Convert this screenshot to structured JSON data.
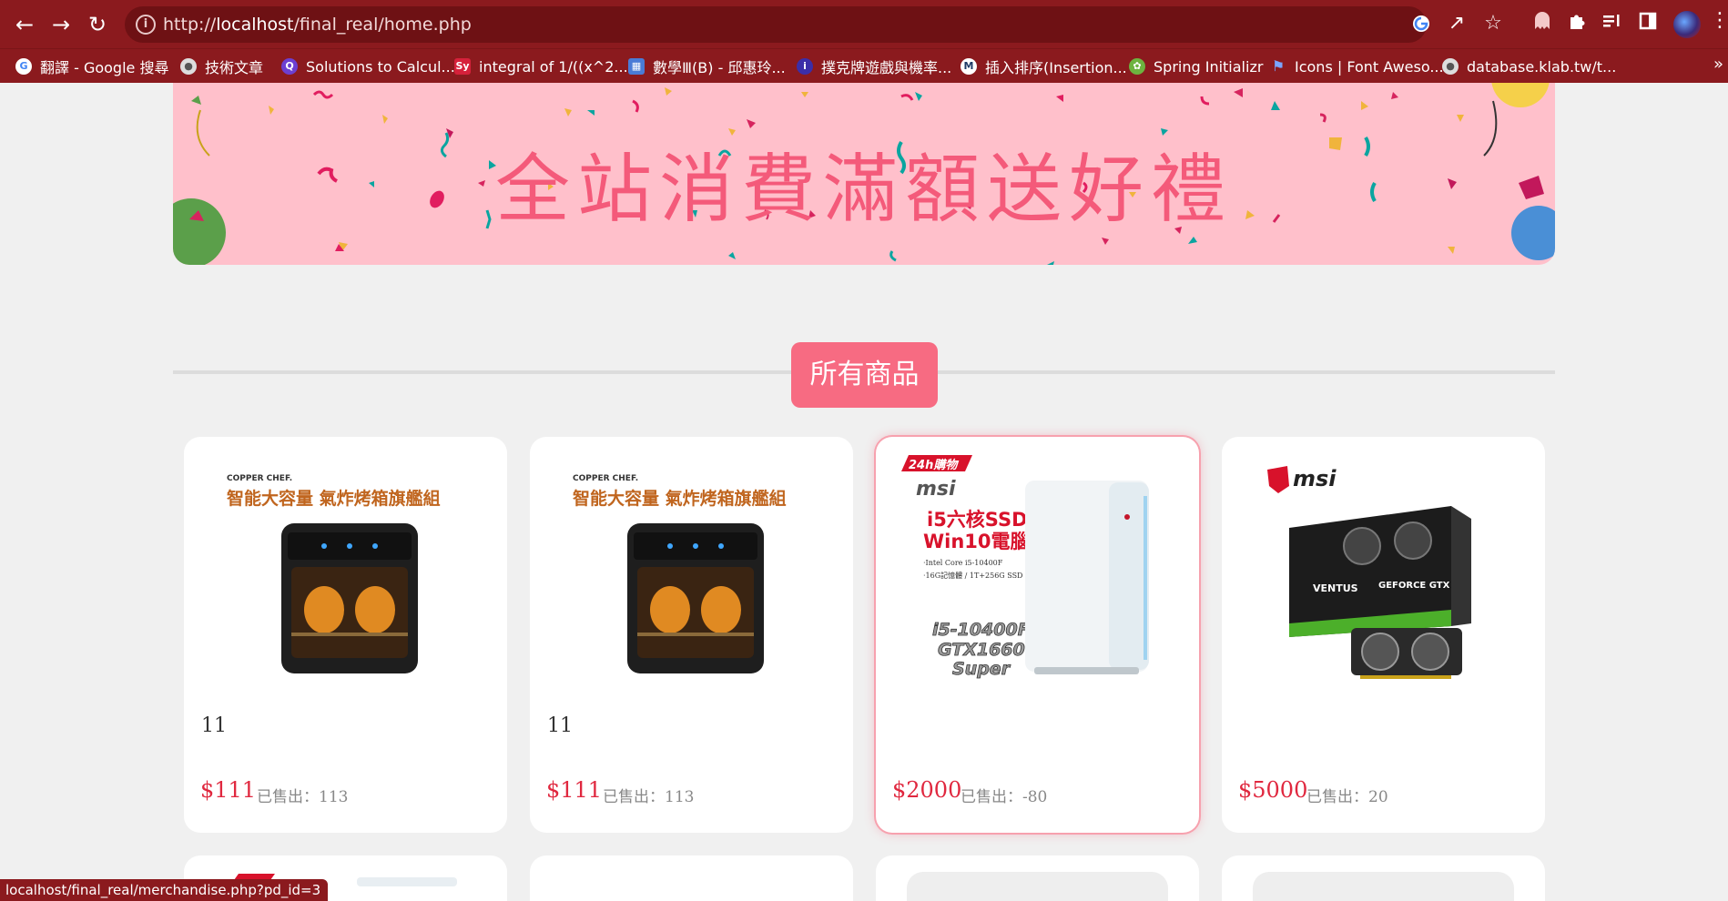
{
  "browser": {
    "url_host": "localhost",
    "url_path": "/final_real/home.php",
    "bookmarks": [
      {
        "label": "翻譯 - Google 搜尋",
        "icon": "google-icon",
        "color": "#4285f4"
      },
      {
        "label": "技術文章",
        "icon": "globe-icon",
        "color": "#777777"
      },
      {
        "label": "Solutions to Calcul...",
        "icon": "q-icon",
        "color": "#6c3fd1"
      },
      {
        "label": "integral of 1/((x^2...",
        "icon": "symbolab-icon",
        "color": "#d6213b"
      },
      {
        "label": "數學Ⅲ(B) - 邱惠玲...",
        "icon": "classroom-icon",
        "color": "#4a7bd6"
      },
      {
        "label": "撲克牌遊戲與機率...",
        "icon": "info-icon",
        "color": "#3b2ea8"
      },
      {
        "label": "插入排序(Insertion...",
        "icon": "m-icon",
        "color": "#1e3a66"
      },
      {
        "label": "Spring Initializr",
        "icon": "spring-icon",
        "color": "#6db33f"
      },
      {
        "label": "Icons | Font Aweso...",
        "icon": "flag-icon",
        "color": "#3b6ee0"
      },
      {
        "label": "database.klab.tw/t...",
        "icon": "globe-icon",
        "color": "#777777"
      }
    ],
    "status_url": "localhost/final_real/merchandise.php?pd_id=3"
  },
  "banner": {
    "title": "全站消費滿額送好禮"
  },
  "section": {
    "title": "所有商品"
  },
  "products": [
    {
      "name": "11",
      "price": "$111",
      "sold_label": "已售出：",
      "sold": "113",
      "image": "air-fryer-oven",
      "img_brand": "COPPER CHEF.",
      "img_caption": "智能大容量 氣炸烤箱旗艦組"
    },
    {
      "name": "11",
      "price": "$111",
      "sold_label": "已售出：",
      "sold": "113",
      "image": "air-fryer-oven",
      "img_brand": "COPPER CHEF.",
      "img_caption": "智能大容量 氣炸烤箱旗艦組"
    },
    {
      "name": "",
      "price": "$2000",
      "sold_label": "已售出：",
      "sold": "-80",
      "image": "msi-desktop-pc",
      "img_badge": "24h購物",
      "img_brand": "msi",
      "img_line1": "i5六核SSD",
      "img_line2": "Win10電腦",
      "img_spec1": "‧Intel Core i5-10400F",
      "img_spec2": "‧16G記憶體 / 1T+256G SSD",
      "img_tag1": "i5-10400F",
      "img_tag2": "GTX1660",
      "img_tag3": "Super"
    },
    {
      "name": "",
      "price": "$5000",
      "sold_label": "已售出：",
      "sold": "20",
      "image": "msi-gtx-graphics-card",
      "img_brand": "msi",
      "img_box1": "VENTUS",
      "img_box2": "GEFORCE GTX"
    }
  ],
  "colors": {
    "chrome": "#8b1a1e",
    "accent": "#f76b82",
    "price": "#e0283f",
    "banner_bg": "#ffc0cb",
    "banner_text": "#f45a7a"
  }
}
